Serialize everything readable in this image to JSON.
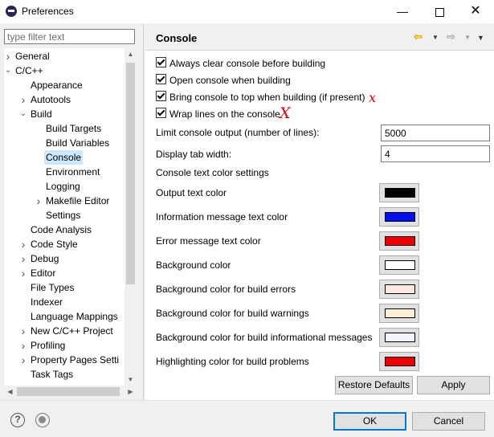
{
  "window": {
    "title": "Preferences",
    "minimize": "—",
    "maximize": "",
    "close": "✕"
  },
  "filter": {
    "placeholder": "type filter text"
  },
  "tree": [
    {
      "label": "General",
      "level": 0,
      "arrow": "›"
    },
    {
      "label": "C/C++",
      "level": 0,
      "arrow": "⌄"
    },
    {
      "label": "Appearance",
      "level": 1,
      "arrow": ""
    },
    {
      "label": "Autotools",
      "level": 1,
      "arrow": "›"
    },
    {
      "label": "Build",
      "level": 1,
      "arrow": "⌄"
    },
    {
      "label": "Build Targets",
      "level": 2,
      "arrow": ""
    },
    {
      "label": "Build Variables",
      "level": 2,
      "arrow": ""
    },
    {
      "label": "Console",
      "level": 2,
      "arrow": "",
      "selected": true
    },
    {
      "label": "Environment",
      "level": 2,
      "arrow": ""
    },
    {
      "label": "Logging",
      "level": 2,
      "arrow": ""
    },
    {
      "label": "Makefile Editor",
      "level": 2,
      "arrow": "›"
    },
    {
      "label": "Settings",
      "level": 2,
      "arrow": ""
    },
    {
      "label": "Code Analysis",
      "level": 1,
      "arrow": ""
    },
    {
      "label": "Code Style",
      "level": 1,
      "arrow": "›"
    },
    {
      "label": "Debug",
      "level": 1,
      "arrow": "›"
    },
    {
      "label": "Editor",
      "level": 1,
      "arrow": "›"
    },
    {
      "label": "File Types",
      "level": 1,
      "arrow": ""
    },
    {
      "label": "Indexer",
      "level": 1,
      "arrow": ""
    },
    {
      "label": "Language Mappings",
      "level": 1,
      "arrow": ""
    },
    {
      "label": "New C/C++ Project",
      "level": 1,
      "arrow": "›"
    },
    {
      "label": "Profiling",
      "level": 1,
      "arrow": "›"
    },
    {
      "label": "Property Pages Setti",
      "level": 1,
      "arrow": "›"
    },
    {
      "label": "Task Tags",
      "level": 1,
      "arrow": ""
    }
  ],
  "page": {
    "title": "Console",
    "checkboxes": [
      {
        "label": "Always clear console before building",
        "checked": true
      },
      {
        "label": "Open console when building",
        "checked": true
      },
      {
        "label": "Bring console to top when building (if present)",
        "checked": true
      },
      {
        "label": "Wrap lines on the console",
        "checked": true
      }
    ],
    "fields": [
      {
        "label": "Limit console output (number of lines):",
        "value": "5000"
      },
      {
        "label": "Display tab width:",
        "value": "4"
      }
    ],
    "color_section": "Console text color settings",
    "colors": [
      {
        "label": "Output text color",
        "color": "#000000"
      },
      {
        "label": "Information message text color",
        "color": "#0011ee"
      },
      {
        "label": "Error message text color",
        "color": "#ee0000"
      },
      {
        "label": "Background color",
        "color": "#ffffff"
      },
      {
        "label": "Background color for build errors",
        "color": "#ffe8e0"
      },
      {
        "label": "Background color for build warnings",
        "color": "#fff0d8"
      },
      {
        "label": "Background color for build informational messages",
        "color": "#f0f4ff"
      },
      {
        "label": "Highlighting color for build problems",
        "color": "#ee0000"
      }
    ],
    "restore_defaults": "Restore Defaults",
    "apply": "Apply",
    "annotations": [
      "x",
      "X"
    ]
  },
  "footer": {
    "ok": "OK",
    "cancel": "Cancel",
    "help": "?"
  }
}
